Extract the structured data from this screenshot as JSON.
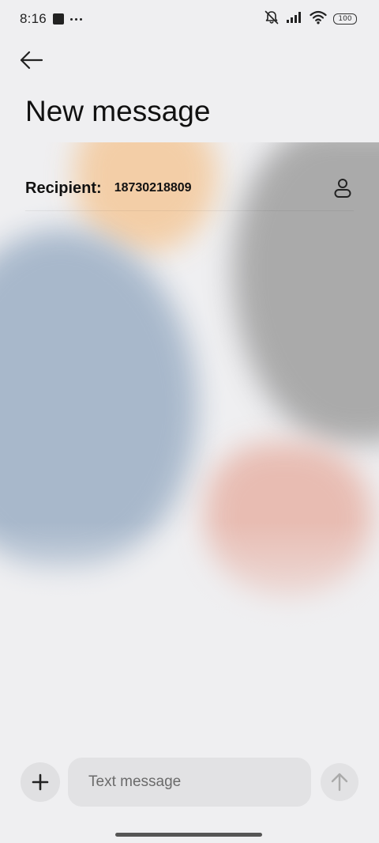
{
  "status_bar": {
    "time": "8:16",
    "battery": "100",
    "icons": [
      "stop-square-icon",
      "more-dots-icon",
      "bell-muted-icon",
      "signal-icon",
      "wifi-icon",
      "battery-icon"
    ]
  },
  "header": {
    "back_icon": "arrow-left-icon",
    "title": "New message"
  },
  "recipient": {
    "label": "Recipient:",
    "value": "18730218809",
    "contact_icon": "person-icon"
  },
  "composer": {
    "add_icon": "plus-icon",
    "placeholder": "Text message",
    "value": "",
    "send_icon": "arrow-up-icon"
  },
  "colors": {
    "background": "#efeff1",
    "blob_orange": "#f4c99b",
    "blob_gray": "#a3a3a3",
    "blob_blue": "#a5b6ca",
    "blob_pink": "#e7b4a8"
  }
}
